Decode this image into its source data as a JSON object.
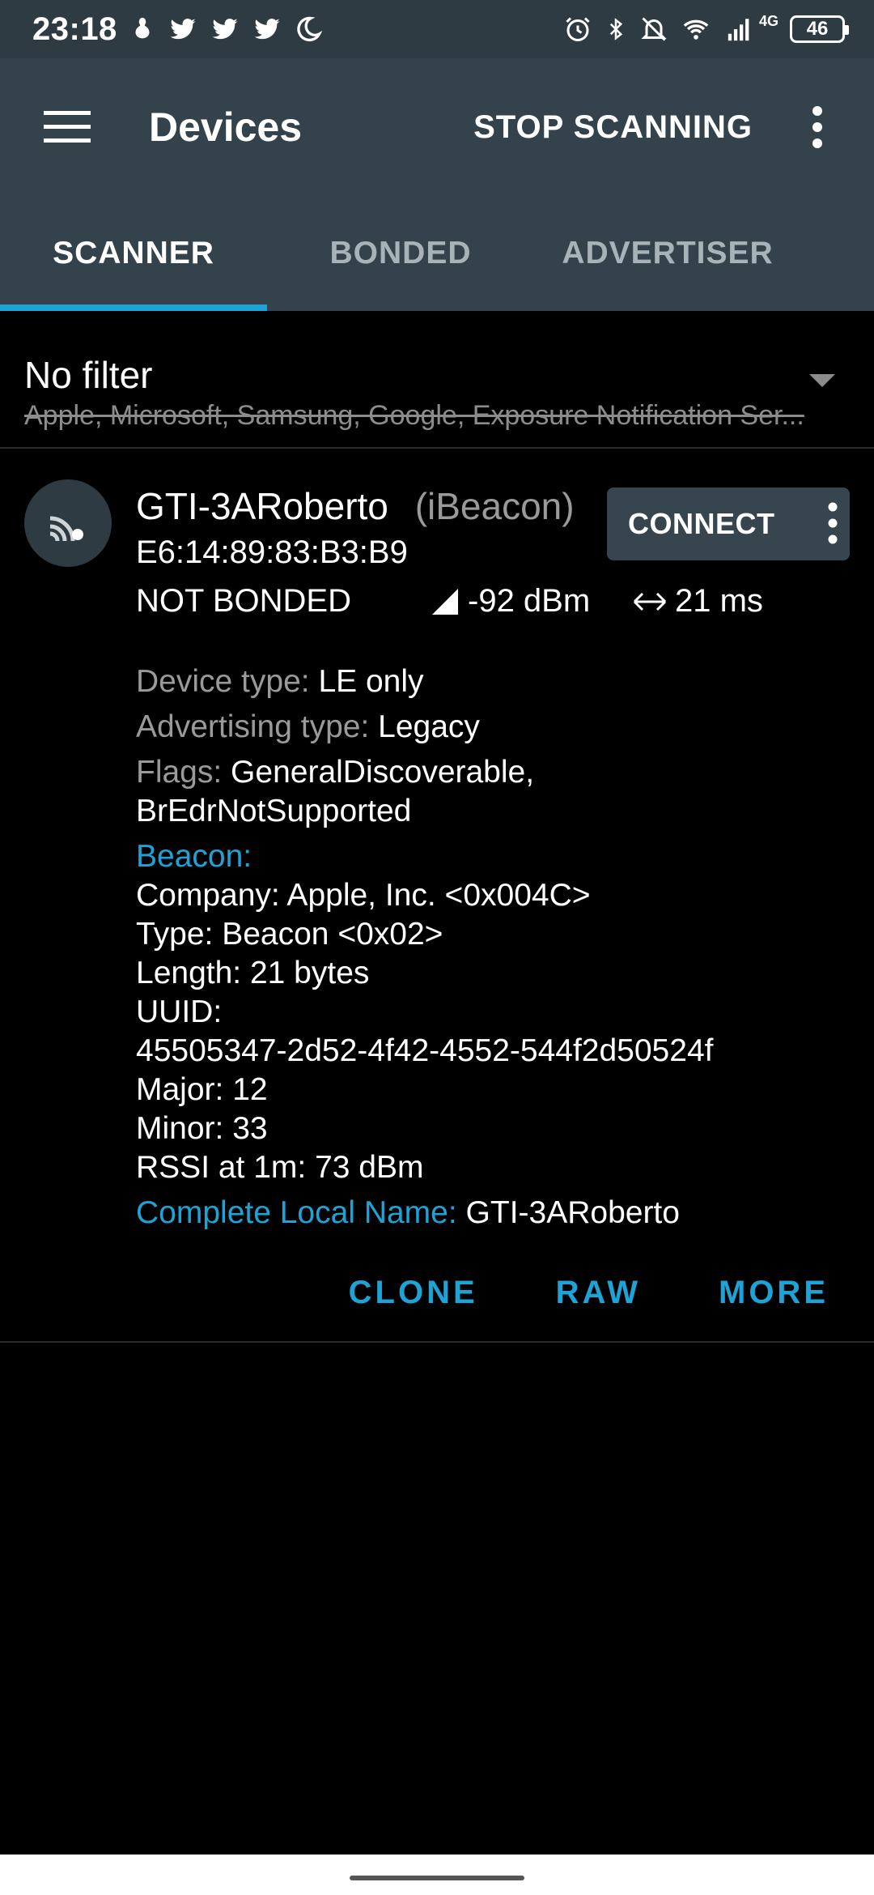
{
  "status_bar": {
    "time": "23:18",
    "network": "4G",
    "battery": "46"
  },
  "app_bar": {
    "title": "Devices",
    "stop_label": "STOP SCANNING"
  },
  "tabs": [
    {
      "label": "SCANNER",
      "active": true
    },
    {
      "label": "BONDED",
      "active": false
    },
    {
      "label": "ADVERTISER",
      "active": false
    }
  ],
  "filter": {
    "title": "No filter",
    "subtitle": "Apple, Microsoft, Samsung, Google, Exposure Notification Ser..."
  },
  "device": {
    "name": "GTI-3ARoberto",
    "kind": "(iBeacon)",
    "mac": "E6:14:89:83:B3:B9",
    "bond_state": "NOT BONDED",
    "rssi": "-92 dBm",
    "interval": "21 ms",
    "connect_label": "CONNECT",
    "details": {
      "device_type_label": "Device type:",
      "device_type": "LE only",
      "adv_type_label": "Advertising type:",
      "adv_type": "Legacy",
      "flags_label": "Flags:",
      "flags_1": "GeneralDiscoverable,",
      "flags_2": "BrEdrNotSupported",
      "beacon_label": "Beacon:",
      "company": "Company: Apple, Inc. <0x004C>",
      "type": "Type: Beacon <0x02>",
      "length": "Length: 21 bytes",
      "uuid_label": "UUID:",
      "uuid": "45505347-2d52-4f42-4552-544f2d50524f",
      "major": "Major: 12",
      "minor": "Minor: 33",
      "rssi_1m": "RSSI at 1m: 73 dBm",
      "local_name_label": "Complete Local Name:",
      "local_name": "GTI-3ARoberto"
    },
    "actions": {
      "clone": "CLONE",
      "raw": "RAW",
      "more": "MORE"
    }
  },
  "colors": {
    "app_bar": "#34434b",
    "accent": "#1ea3d6",
    "background": "#000000"
  }
}
